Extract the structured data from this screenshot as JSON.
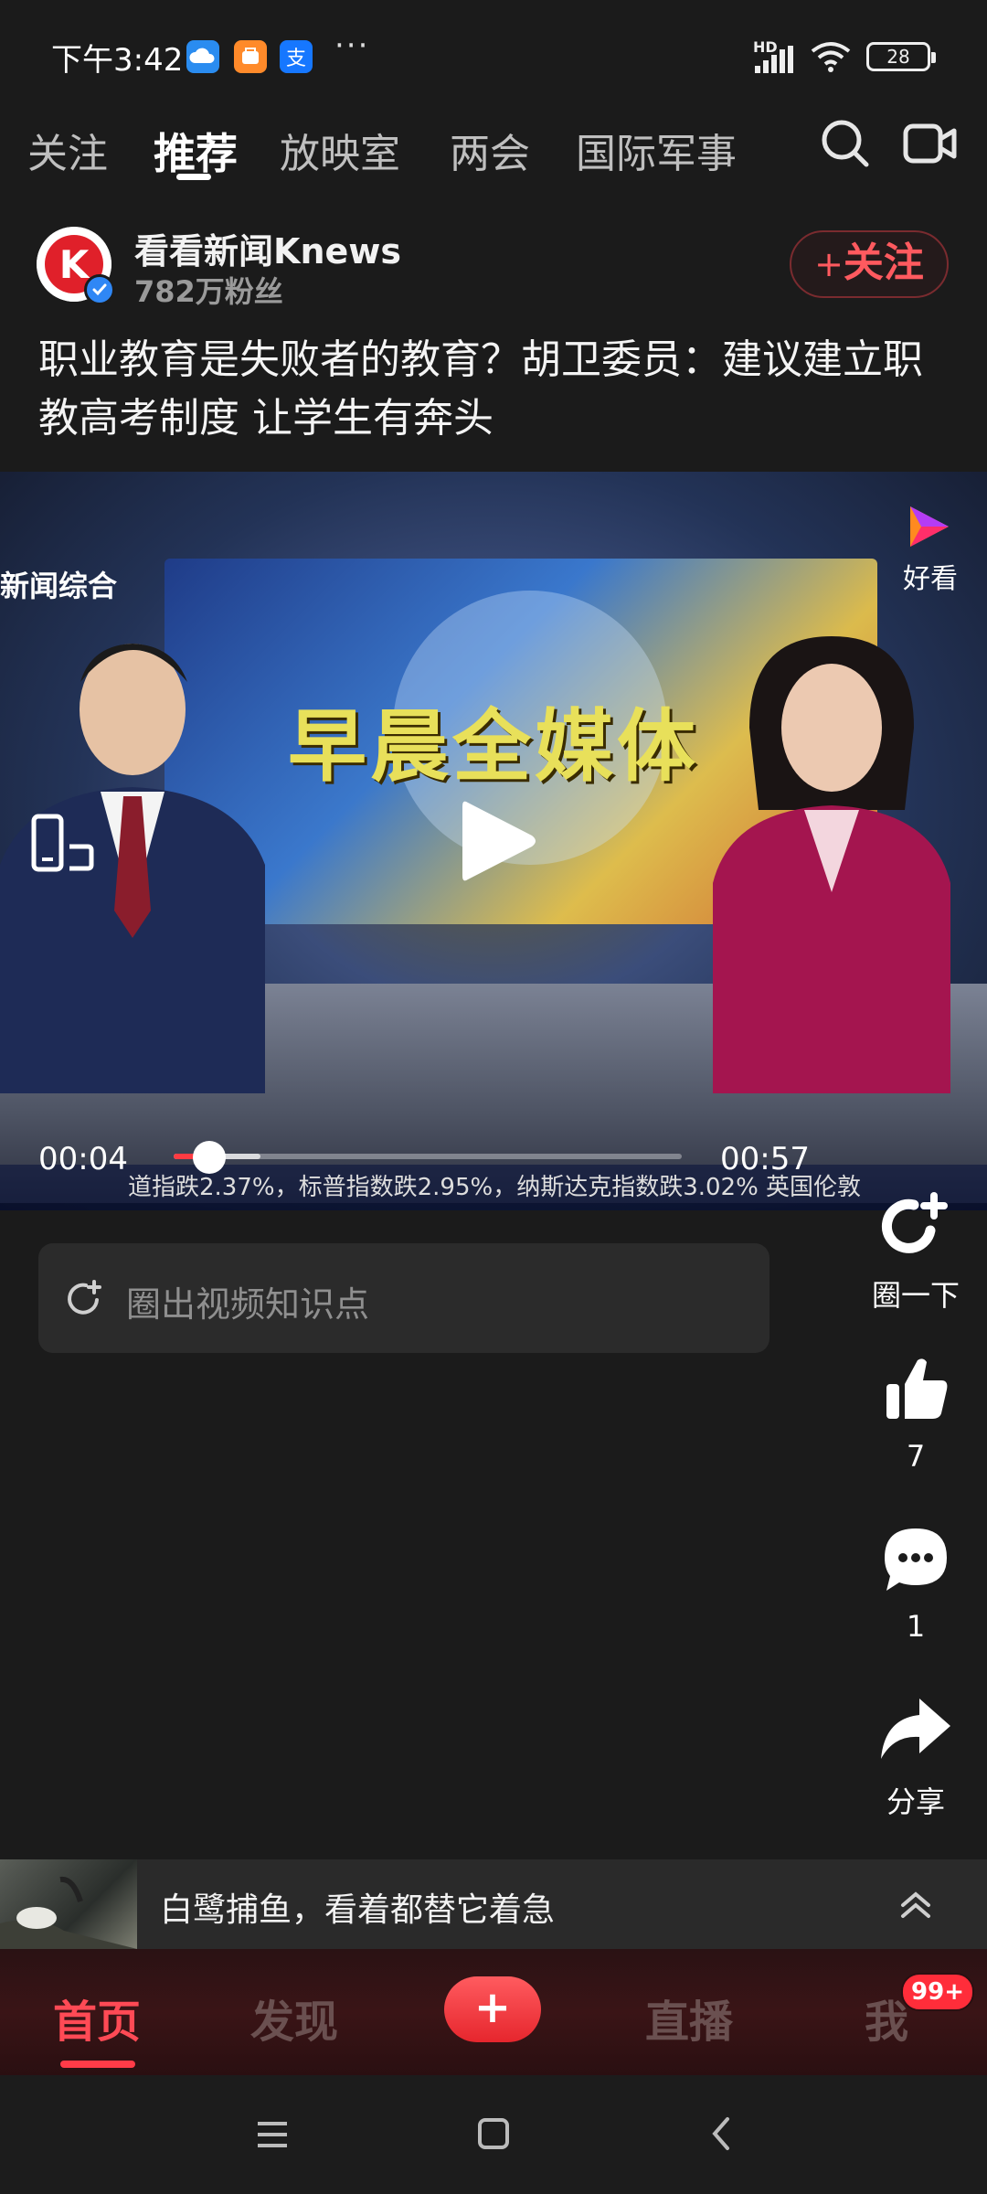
{
  "status_bar": {
    "time": "下午3:42",
    "more": "···",
    "network_label": "HD",
    "battery": "28"
  },
  "tabs": [
    "关注",
    "推荐",
    "放映室",
    "两会",
    "国际军事"
  ],
  "active_tab": "推荐",
  "author": {
    "name": "看看新闻Knews",
    "fans": "782万粉丝",
    "avatar_letter": "K",
    "follow_label": "关注"
  },
  "post": {
    "title": "职业教育是失败者的教育？胡卫委员：建议建立职教高考制度 让学生有奔头"
  },
  "video": {
    "channel_label": "新闻综合",
    "banner_text": "早晨全媒体",
    "source_badge": "好看",
    "current_time": "00:04",
    "duration": "00:57",
    "progress": 0.07,
    "buffered": 0.17,
    "ticker": "道指跌2.37%，标普指数跌2.95%，纳斯达克指数跌3.02%    英国伦敦"
  },
  "knowledge": {
    "placeholder": "圈出视频知识点"
  },
  "actions": {
    "circle_label": "圈一下",
    "like_count": "7",
    "comment_count": "1",
    "share_label": "分享"
  },
  "next_video": {
    "title": "白鹭捕鱼，看着都替它着急"
  },
  "bottom_nav": {
    "home": "首页",
    "discover": "发现",
    "plus": "+",
    "live": "直播",
    "me": "我",
    "badge": "99+"
  },
  "colors": {
    "accent": "#ff3b48",
    "background": "#1b1b1b",
    "follow_text": "#ff5a5f"
  }
}
